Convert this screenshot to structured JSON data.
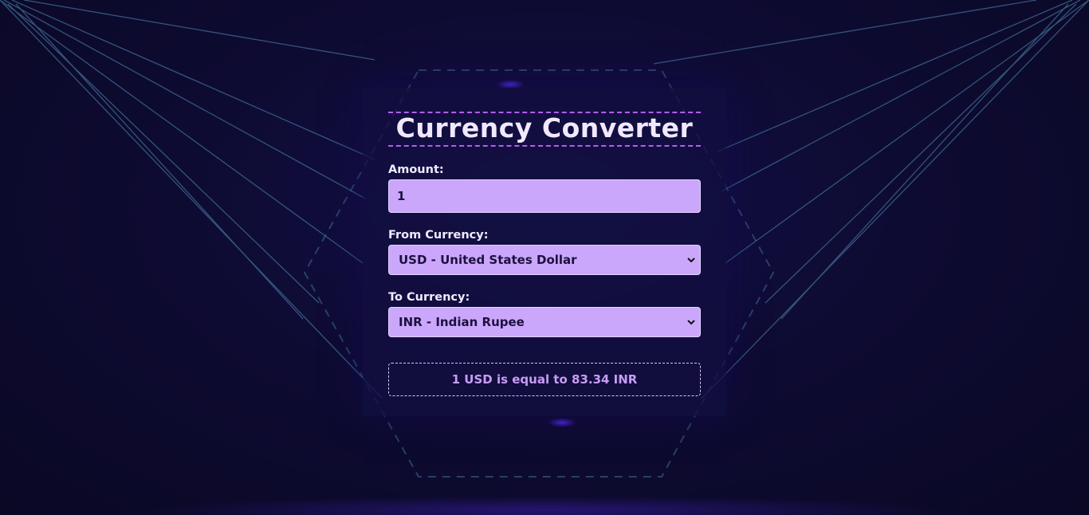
{
  "app": {
    "title": "Currency Converter"
  },
  "form": {
    "amount_label": "Amount:",
    "amount_value": "1",
    "from_label": "From Currency:",
    "from_selected": "USD - United States Dollar",
    "to_label": "To Currency:",
    "to_selected": "INR - Indian Rupee"
  },
  "result": {
    "text": "1 USD is equal to 83.34 INR"
  },
  "colors": {
    "background": "#0d0a2a",
    "card": "#121040",
    "field_fill": "#cba7fb",
    "title_border": "#b65cf0",
    "result_text": "#c89cf5",
    "line_accent": "#4d7aa6"
  },
  "icons": {
    "select_arrow": "chevron-down-icon"
  }
}
